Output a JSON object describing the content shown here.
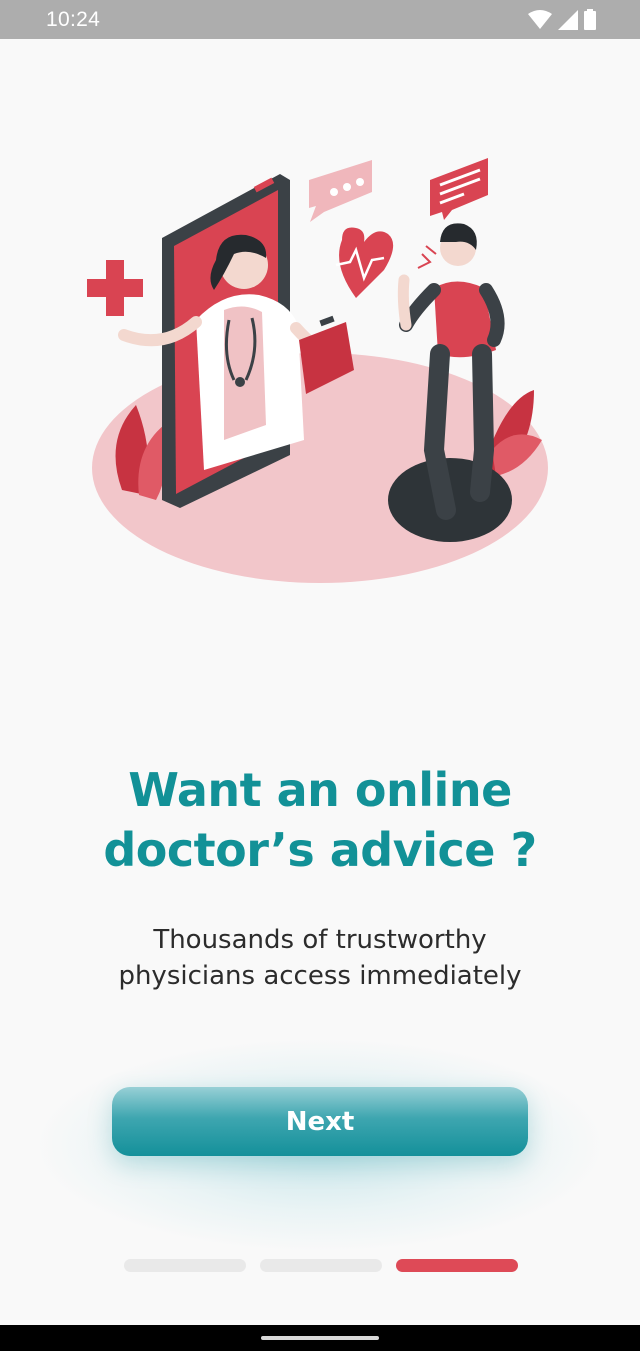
{
  "status_bar": {
    "time": "10:24",
    "icons": [
      "wifi-icon",
      "signal-icon",
      "battery-icon"
    ]
  },
  "illustration": {
    "name": "online-doctor-consultation-illustration"
  },
  "onboarding": {
    "title_line1": "Want an online",
    "title_line2": "doctor’s advice ?",
    "subtitle_line1": "Thousands of trustworthy",
    "subtitle_line2": "physicians access immediately",
    "next_label": "Next"
  },
  "pager": {
    "total_pages": 3,
    "current_page": 3
  },
  "colors": {
    "accent": "#129197",
    "active_page": "#de4a57",
    "illustration_red": "#d94452"
  }
}
